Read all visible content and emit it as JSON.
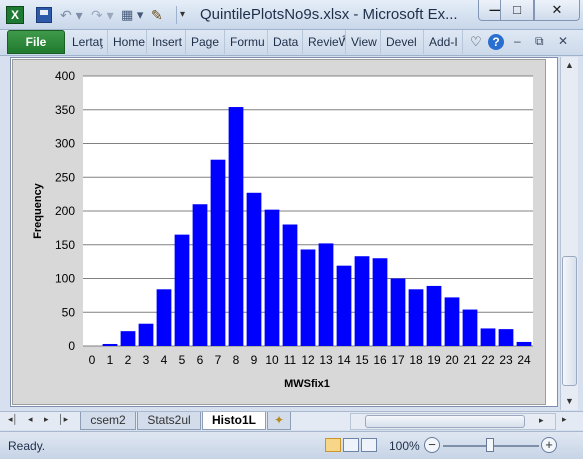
{
  "window": {
    "title": "QuintilePlotsNo9s.xlsx - Microsoft Ex...",
    "min_glyph": "—",
    "max_glyph": "□",
    "close_glyph": "✕"
  },
  "qat": {
    "app_icon": "excel-icon",
    "undo_glyph": "↶ ▾",
    "redo_glyph": "↷ ▾",
    "layout_glyph": "▦ ▾",
    "brush_glyph": "✎",
    "customize_glyph": "▾"
  },
  "ribbon": {
    "file_label": "File",
    "tabs": [
      "Lertaţ",
      "Home",
      "Insert",
      "Page",
      "Formu",
      "Data",
      "RevieŴ",
      "View",
      "Devel",
      "Add-I"
    ],
    "heart_glyph": "♡",
    "help_glyph": "?",
    "win_min_glyph": "–",
    "win_restore_glyph": "⧉",
    "win_close_glyph": "✕"
  },
  "chart_data": {
    "type": "bar",
    "categories": [
      "0",
      "1",
      "2",
      "3",
      "4",
      "5",
      "6",
      "7",
      "8",
      "9",
      "10",
      "11",
      "12",
      "13",
      "14",
      "15",
      "16",
      "17",
      "18",
      "19",
      "20",
      "21",
      "22",
      "23",
      "24"
    ],
    "values": [
      0,
      3,
      22,
      33,
      84,
      165,
      210,
      276,
      354,
      227,
      202,
      180,
      143,
      152,
      119,
      133,
      130,
      100,
      84,
      89,
      72,
      54,
      26,
      25,
      6
    ],
    "xlabel": "MWSfix1",
    "ylabel": "Frequency",
    "ylim": [
      0,
      400
    ],
    "yticks": [
      "0",
      "50",
      "100",
      "150",
      "200",
      "250",
      "300",
      "350",
      "400"
    ],
    "grid": true,
    "bar_color": "#0000ff"
  },
  "sheets": {
    "nav": [
      "◂│",
      "◂",
      "▸",
      "│▸"
    ],
    "tabs": [
      "csem2",
      "Stats2ul",
      "Histo1L"
    ],
    "active": "Histo1L",
    "new_sheet_icon": "insert-sheet-icon"
  },
  "status": {
    "text": "Ready.",
    "zoom": "100%",
    "zoom_fraction": 0.5,
    "zoom_out_glyph": "−",
    "zoom_in_glyph": "+"
  },
  "scroll": {
    "up_glyph": "▲",
    "down_glyph": "▼",
    "left_glyph": "◂",
    "right_glyph": "▸"
  }
}
